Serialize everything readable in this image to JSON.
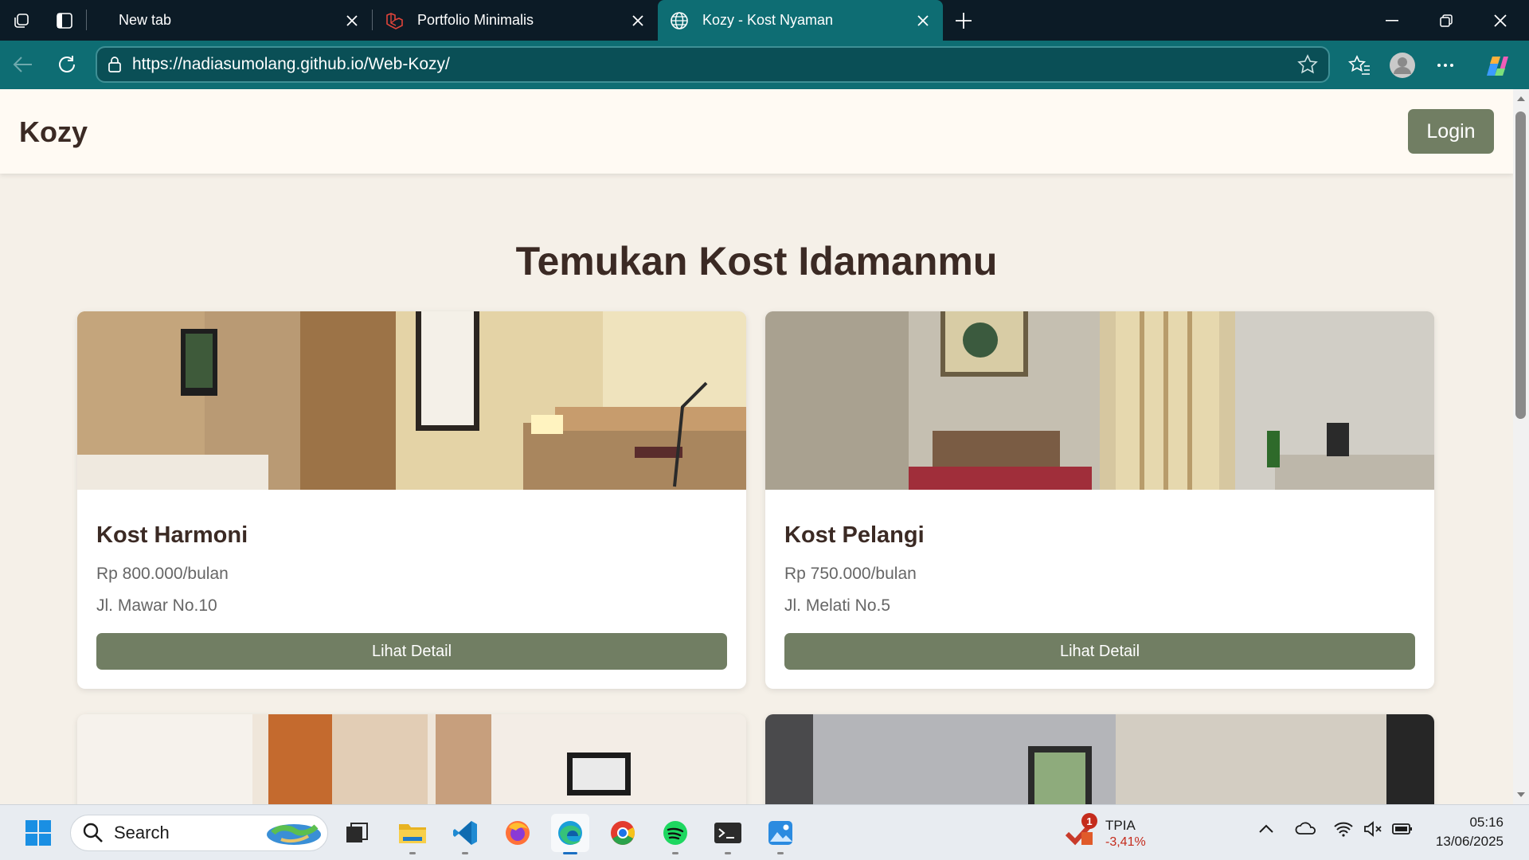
{
  "browser": {
    "tabs": [
      {
        "title": "New tab",
        "active": false
      },
      {
        "title": "Portfolio Minimalis",
        "active": false
      },
      {
        "title": "Kozy - Kost Nyaman",
        "active": true
      }
    ],
    "url": "https://nadiasumolang.github.io/Web-Kozy/"
  },
  "site": {
    "brand": "Kozy",
    "login_label": "Login",
    "hero_title": "Temukan Kost Idamanmu",
    "listings": [
      {
        "name": "Kost Harmoni",
        "price": "Rp 800.000/bulan",
        "address": "Jl. Mawar No.10",
        "button": "Lihat Detail"
      },
      {
        "name": "Kost Pelangi",
        "price": "Rp 750.000/bulan",
        "address": "Jl. Melati No.5",
        "button": "Lihat Detail"
      }
    ]
  },
  "taskbar": {
    "search_placeholder": "Search",
    "stock": {
      "ticker": "TPIA",
      "change": "-3,41%",
      "badge": "1"
    },
    "time": "05:16",
    "date": "13/06/2025"
  },
  "colors": {
    "accent_green": "#717e63",
    "browser_teal": "#0e6d73",
    "text_dark": "#3b2a24",
    "page_bg": "#f5f0e8"
  }
}
